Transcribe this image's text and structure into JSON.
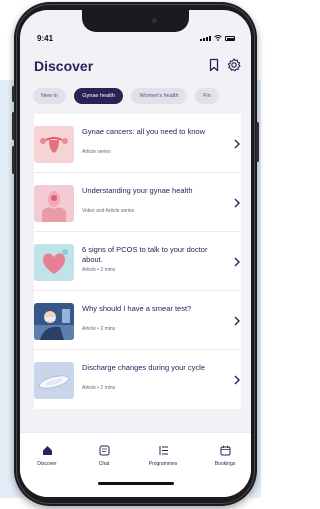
{
  "status": {
    "time": "9:41"
  },
  "header": {
    "title": "Discover",
    "bookmark_icon": "bookmark-icon",
    "settings_icon": "gear-icon"
  },
  "tabs": [
    {
      "label": "New in",
      "active": false
    },
    {
      "label": "Gynae health",
      "active": true
    },
    {
      "label": "Women's health",
      "active": false
    },
    {
      "label": "Fin",
      "active": false
    }
  ],
  "articles": [
    {
      "title": "Gynae cancers: all you need to know",
      "meta": "Article series",
      "thumb": "uterus-illustration"
    },
    {
      "title": "Understanding your gynae health",
      "meta": "Video and Article series",
      "thumb": "hands-holding-illustration"
    },
    {
      "title": "6 signs of PCOS to talk to your doctor about.",
      "meta": "Article • 2 mins",
      "thumb": "heart-illustration"
    },
    {
      "title": "Why should I have a smear test?",
      "meta": "Article • 2 mins",
      "thumb": "doctor-photo"
    },
    {
      "title": "Discharge changes during your cycle",
      "meta": "Article • 2 mins",
      "thumb": "pad-photo"
    }
  ],
  "tabbar": [
    {
      "label": "Discover",
      "icon": "home-icon"
    },
    {
      "label": "Chat",
      "icon": "chat-icon"
    },
    {
      "label": "Programmes",
      "icon": "list-icon"
    },
    {
      "label": "Bookings",
      "icon": "calendar-icon"
    }
  ],
  "colors": {
    "brand": "#2d2158",
    "background": "#f2f1f6",
    "accent_panel": "#e4edf7"
  }
}
